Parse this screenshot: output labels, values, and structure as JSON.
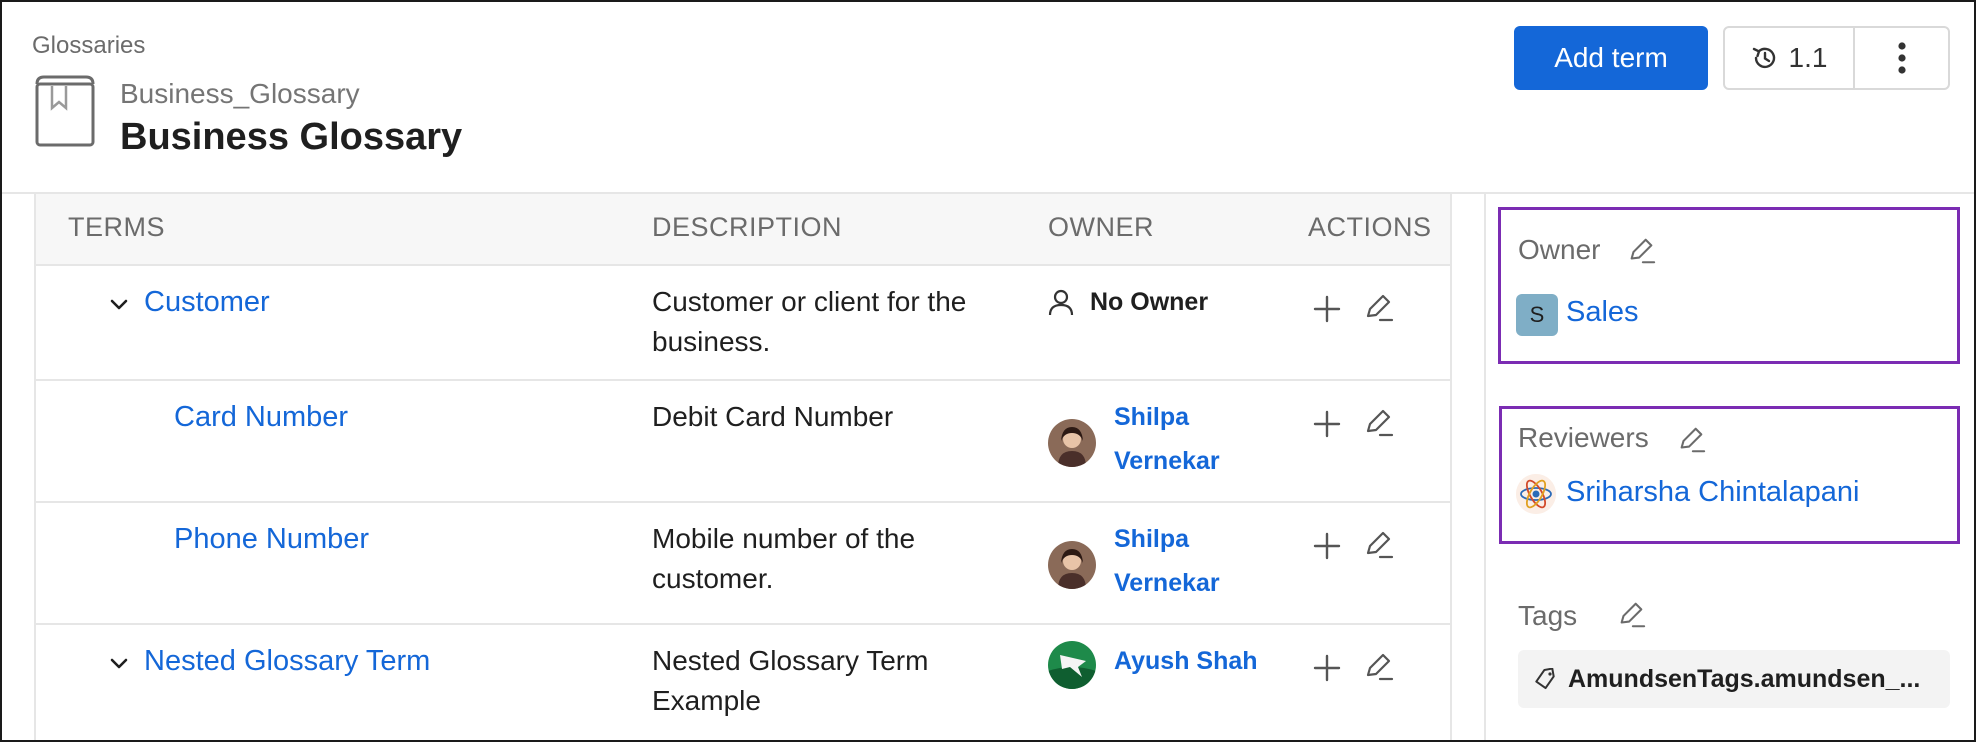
{
  "header": {
    "breadcrumb": "Glossaries",
    "subtitle": "Business_Glossary",
    "title": "Business Glossary",
    "add_term_label": "Add term",
    "version_label": "1.1",
    "icons": {
      "glossary": "book-icon",
      "version": "history-icon",
      "more": "more-vertical-icon"
    }
  },
  "table": {
    "columns": [
      "TERMS",
      "DESCRIPTION",
      "OWNER",
      "ACTIONS"
    ],
    "rows": [
      {
        "term": "Customer",
        "expandable": true,
        "description": "Customer or client for the business.",
        "desc_lines": [
          "Customer or client for the",
          "business."
        ],
        "owner": "No Owner",
        "owner_lines": [
          "No Owner"
        ]
      },
      {
        "term": "Card Number",
        "expandable": false,
        "description": "Debit Card Number",
        "desc_lines": [
          "Debit Card Number"
        ],
        "owner": "Shilpa Vernekar",
        "owner_lines": [
          "Shilpa",
          "Vernekar"
        ]
      },
      {
        "term": "Phone Number",
        "expandable": false,
        "description": "Mobile number of the customer.",
        "desc_lines": [
          "Mobile number of the",
          "customer."
        ],
        "owner": "Shilpa Vernekar",
        "owner_lines": [
          "Shilpa",
          "Vernekar"
        ]
      },
      {
        "term": "Nested Glossary Term",
        "expandable": true,
        "description": "Nested Glossary Term Example",
        "desc_lines": [
          "Nested Glossary Term",
          "Example"
        ],
        "owner": "Ayush Shah",
        "owner_lines": [
          "Ayush Shah"
        ]
      }
    ]
  },
  "panel": {
    "owner_label": "Owner",
    "owner_badge": "S",
    "owner_name": "Sales",
    "reviewers_label": "Reviewers",
    "reviewer_name": "Sriharsha Chintalapani",
    "tags_label": "Tags",
    "tag": "AmundsenTags.amundsen_..."
  },
  "colors": {
    "accent": "#1467d8",
    "highlight_box": "#7b2cb3",
    "muted_text": "#6b6b6b"
  }
}
